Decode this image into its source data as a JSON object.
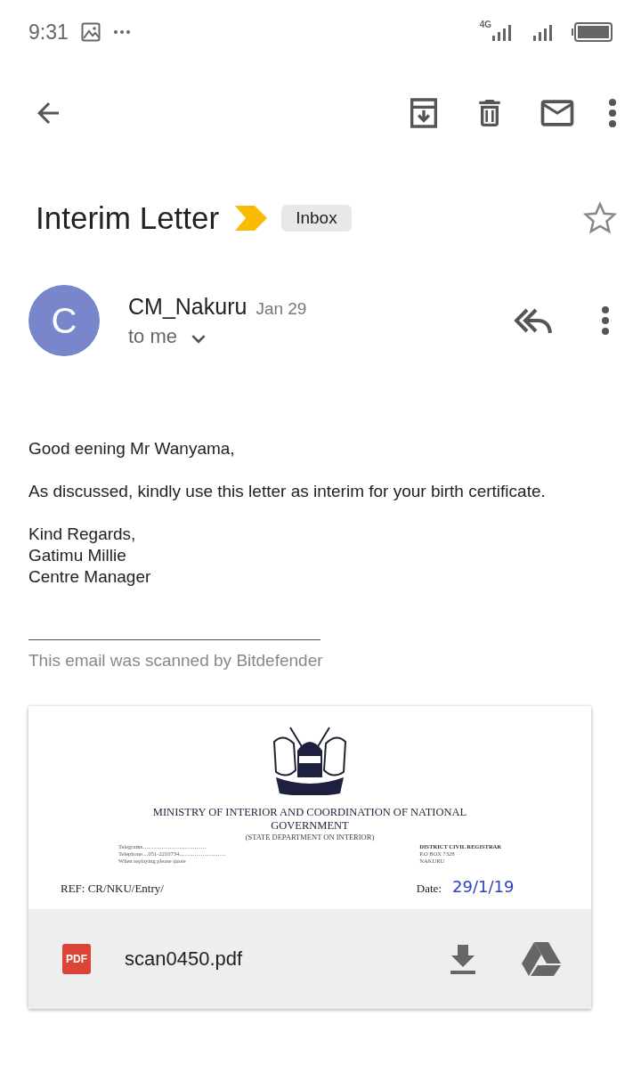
{
  "status_bar": {
    "time": "9:31",
    "network": "4G"
  },
  "subject": {
    "title": "Interim Letter",
    "important": true,
    "label": "Inbox",
    "starred": false
  },
  "message": {
    "avatar_letter": "C",
    "sender": "CM_Nakuru",
    "date": "Jan 29",
    "recipient": "to me",
    "body": [
      "Good eening Mr Wanyama,",
      "As discussed, kindly use this letter as interim for your birth certificate."
    ],
    "signature": [
      "Kind Regards,",
      "Gatimu Millie",
      "Centre Manager"
    ],
    "footer": "This email was scanned by Bitdefender"
  },
  "attachment": {
    "preview": {
      "heading": "MINISTRY OF INTERIOR AND COORDINATION OF NATIONAL GOVERNMENT",
      "subheading": "(STATE DEPARTMENT ON INTERIOR)",
      "left_lines": [
        "Telegrams……………………………",
        "Telephone…051-2210734……………………",
        "When replaying please quote"
      ],
      "right_lines": [
        "DISTRICT CIVIL REGISTRAR",
        "P.O BOX    7328",
        "NAKURU"
      ],
      "ref": "REF: CR/NKU/Entry/",
      "date_label": "Date:",
      "date_value": "29/1/19"
    },
    "file_type": "PDF",
    "file_name": "scan0450.pdf"
  }
}
